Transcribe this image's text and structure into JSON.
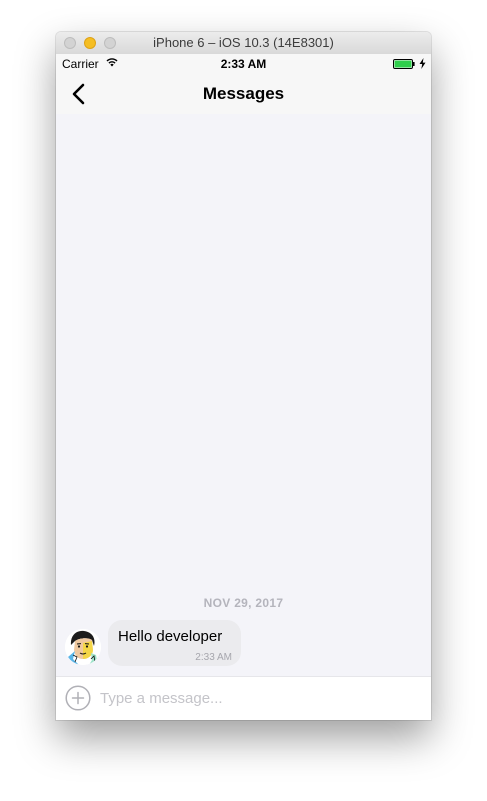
{
  "window": {
    "title": "iPhone 6 – iOS 10.3 (14E8301)"
  },
  "status_bar": {
    "carrier": "Carrier",
    "time": "2:33 AM",
    "wifi_icon": "wifi-icon",
    "battery_icon": "battery-icon",
    "charging_icon": "charging-bolt-icon",
    "battery_color": "#2fcf4c"
  },
  "nav": {
    "back_icon": "chevron-left-icon",
    "title": "Messages"
  },
  "chat": {
    "date_separator": "NOV 29, 2017",
    "messages": [
      {
        "text": "Hello developer",
        "time": "2:33 AM",
        "avatar": "avatar"
      }
    ]
  },
  "composer": {
    "add_icon": "plus-circle-icon",
    "placeholder": "Type a message...",
    "value": ""
  }
}
